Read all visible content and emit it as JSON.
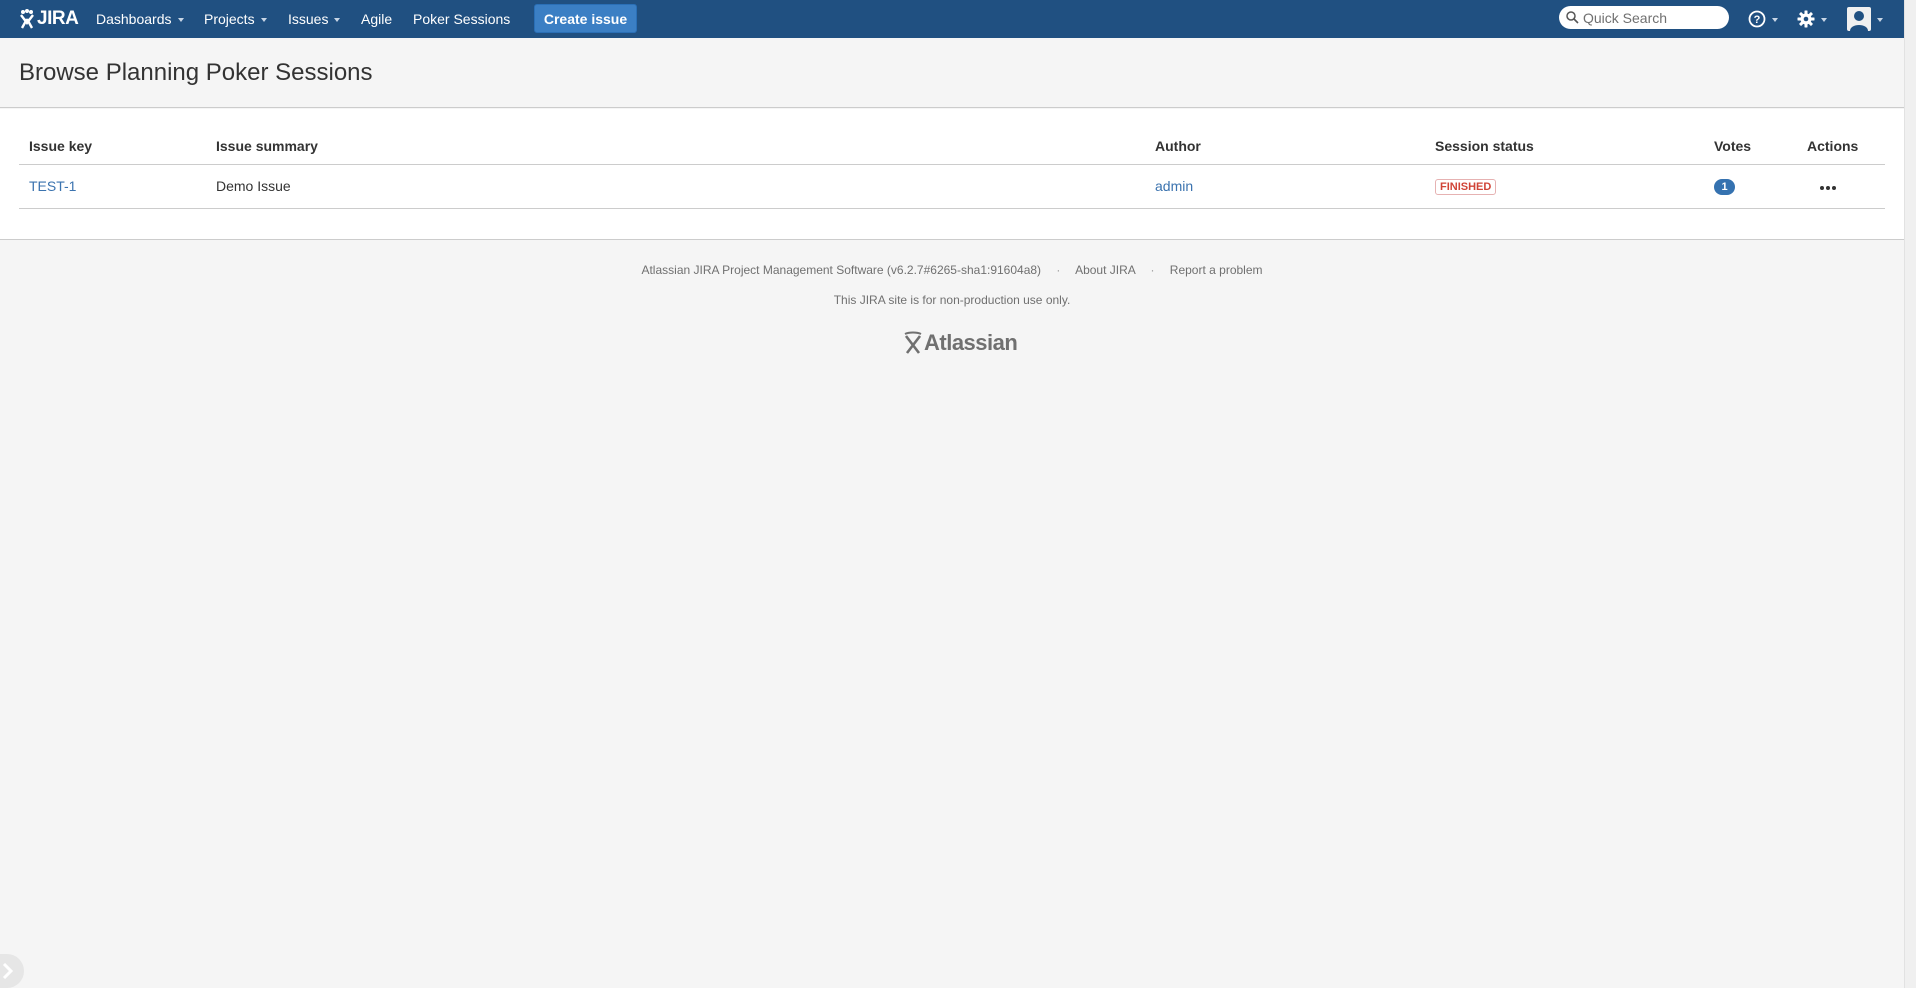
{
  "header": {
    "logo_text": "JIRA",
    "nav": [
      {
        "label": "Dashboards",
        "has_caret": true
      },
      {
        "label": "Projects",
        "has_caret": true
      },
      {
        "label": "Issues",
        "has_caret": true
      },
      {
        "label": "Agile",
        "has_caret": false
      },
      {
        "label": "Poker Sessions",
        "has_caret": false
      }
    ],
    "create_label": "Create issue",
    "search_placeholder": "Quick Search",
    "icons": [
      "help-icon",
      "gear-icon",
      "user-avatar-icon"
    ],
    "colors": {
      "bar": "#205081",
      "button": "#3b7fc4"
    }
  },
  "page": {
    "title": "Browse Planning Poker Sessions"
  },
  "table": {
    "columns": [
      "Issue key",
      "Issue summary",
      "Author",
      "Session status",
      "Votes",
      "Actions"
    ],
    "rows": [
      {
        "issue_key": "TEST-1",
        "summary": "Demo Issue",
        "author": "admin",
        "status": "FINISHED",
        "votes": "1",
        "actions_icon": "more-icon"
      }
    ]
  },
  "footer": {
    "software": "Atlassian JIRA Project Management Software (v6.2.7#6265-sha1:91604a8)",
    "separator": "·",
    "about": "About JIRA",
    "report": "Report a problem",
    "notice": "This JIRA site is for non-production use only.",
    "logo_text": "Atlassian"
  }
}
